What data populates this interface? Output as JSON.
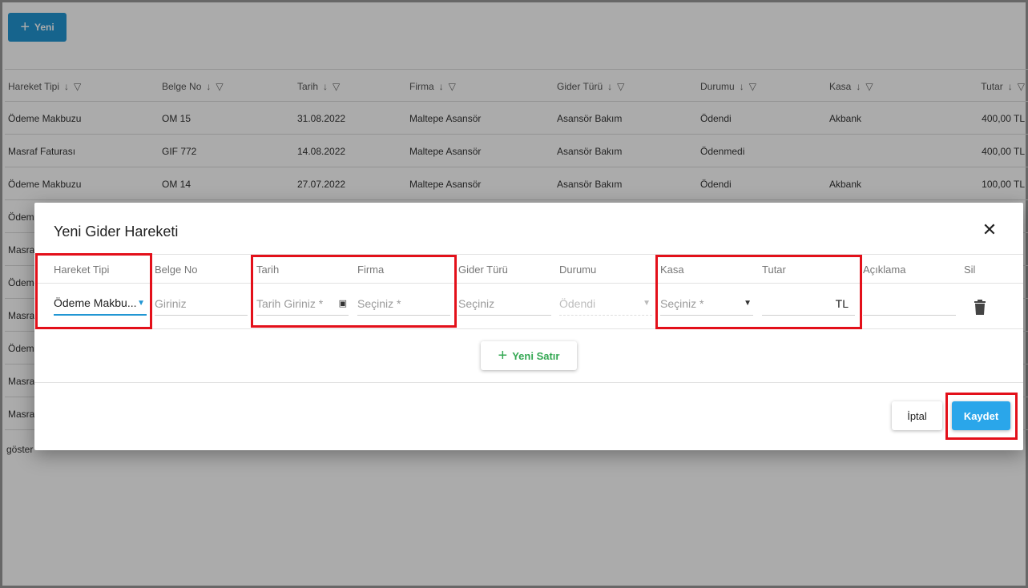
{
  "toolbar": {
    "new_label": "Yeni"
  },
  "grid": {
    "columns": [
      "Hareket Tipi",
      "Belge No",
      "Tarih",
      "Firma",
      "Gider Türü",
      "Durumu",
      "Kasa",
      "Tutar"
    ],
    "rows": [
      [
        "Ödeme Makbuzu",
        "OM 15",
        "31.08.2022",
        "Maltepe Asansör",
        "Asansör Bakım",
        "Ödendi",
        "Akbank",
        "400,00 TL"
      ],
      [
        "Masraf Faturası",
        "GIF 772",
        "14.08.2022",
        "Maltepe Asansör",
        "Asansör Bakım",
        "Ödenmedi",
        "",
        "400,00 TL"
      ],
      [
        "Ödeme Makbuzu",
        "OM 14",
        "27.07.2022",
        "Maltepe Asansör",
        "Asansör Bakım",
        "Ödendi",
        "Akbank",
        "100,00 TL"
      ]
    ],
    "partial_rows": [
      "Ödeme",
      "Masraf",
      "Ödeme",
      "Masraf",
      "Ödeme",
      "Masraf",
      "Masraf"
    ],
    "pager_text": "göster"
  },
  "dialog": {
    "title": "Yeni Gider Hareketi",
    "columns": [
      "Hareket Tipi",
      "Belge No",
      "Tarih",
      "Firma",
      "Gider Türü",
      "Durumu",
      "Kasa",
      "Tutar",
      "Açıklama",
      "Sil"
    ],
    "row": {
      "hareket_tipi": "Ödeme Makbu...",
      "belge_no_placeholder": "Giriniz",
      "tarih_placeholder": "Tarih Giriniz *",
      "firma_placeholder": "Seçiniz *",
      "gider_turu_placeholder": "Seçiniz",
      "durumu_value": "Ödendi",
      "kasa_placeholder": "Seçiniz *",
      "tutar_suffix": "TL"
    },
    "add_row_label": "Yeni Satır",
    "cancel_label": "İptal",
    "save_label": "Kaydet"
  },
  "colors": {
    "accent": "#2196d3",
    "save": "#2aa6ea",
    "add_row": "#34a853",
    "highlight": "#e3101a"
  },
  "icons": [
    "plus-icon",
    "sort-down-icon",
    "filter-icon",
    "close-icon",
    "dropdown-arrow-icon",
    "calendar-icon",
    "trash-icon"
  ]
}
